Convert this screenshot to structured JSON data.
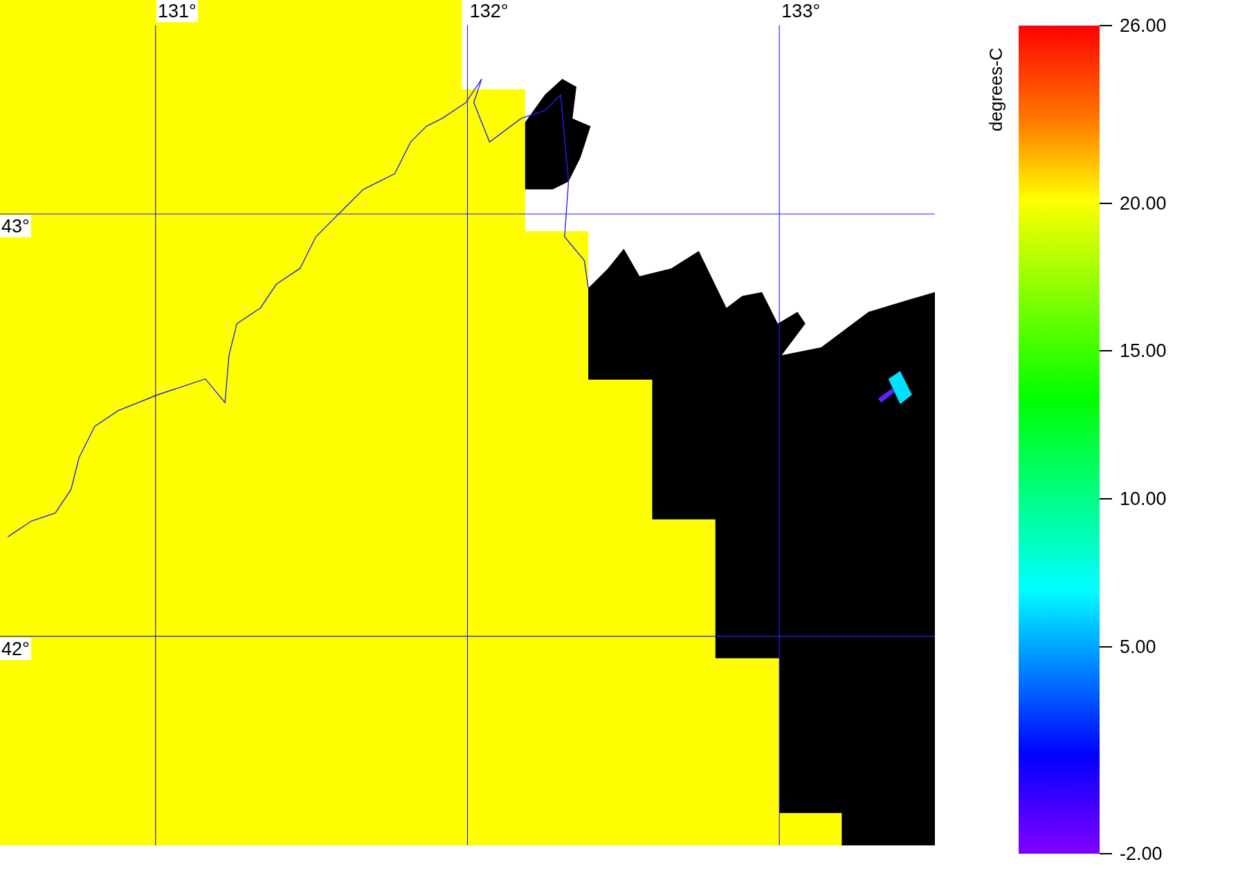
{
  "map": {
    "longitude_labels": [
      "131°",
      "132°",
      "133°"
    ],
    "latitude_labels": [
      "43°",
      "42°"
    ]
  },
  "colorbar": {
    "unit": "degrees-C",
    "tick_labels": [
      "26.00",
      "20.00",
      "15.00",
      "10.00",
      "5.00",
      "-2.00"
    ]
  }
}
